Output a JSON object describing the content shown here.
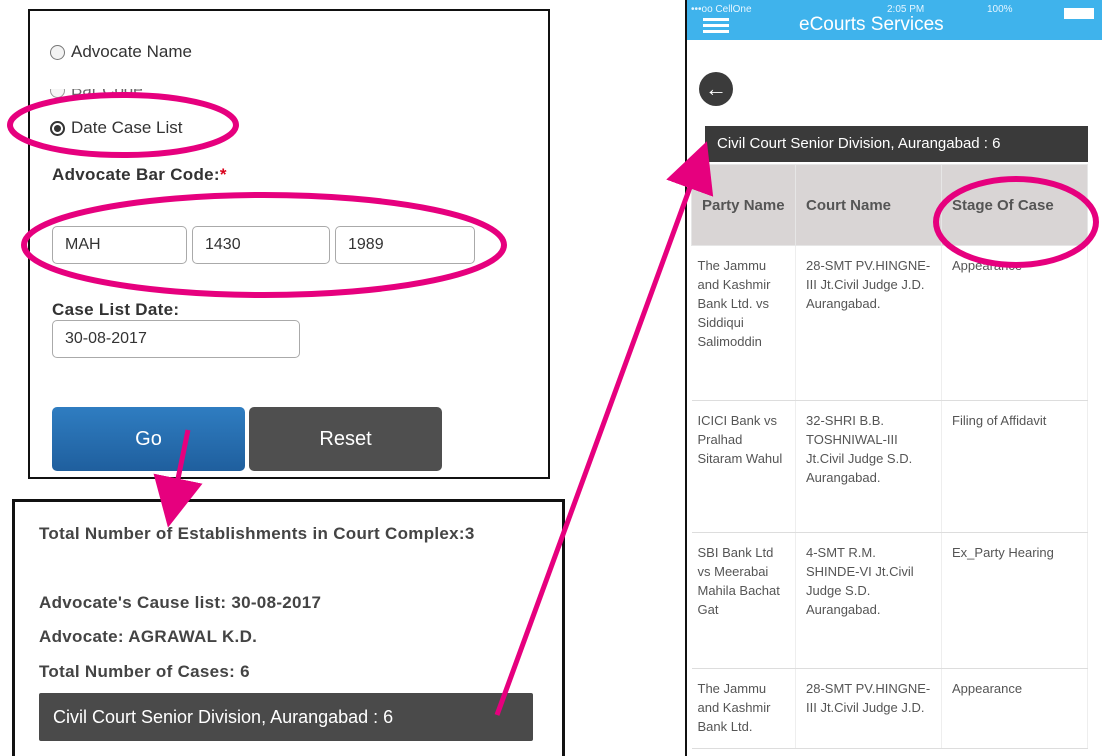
{
  "form": {
    "radio_options": [
      {
        "label": "Advocate Name",
        "checked": false
      },
      {
        "label": "Bar Code",
        "checked": false
      },
      {
        "label": "Date Case List",
        "checked": true
      }
    ],
    "bar_code_label": "Advocate Bar Code:",
    "required_mark": "*",
    "bar_code_state": "MAH",
    "bar_code_number": "1430",
    "bar_code_year": "1989",
    "case_list_date_label": "Case List Date:",
    "case_list_date": "30-08-2017",
    "go_label": "Go",
    "reset_label": "Reset"
  },
  "summary": {
    "establishments": "Total Number of Establishments in Court Complex:3",
    "cause_list": "Advocate's Cause list: 30-08-2017",
    "advocate": "Advocate: AGRAWAL K.D.",
    "total_cases": "Total Number of Cases: 6",
    "court_item": "Civil Court Senior Division, Aurangabad : 6"
  },
  "phone": {
    "carrier": "•••oo CellOne",
    "time": "2:05 PM",
    "battery": "100%",
    "app_title": "eCourts Services",
    "back_icon": "arrow-left-icon",
    "court_header": "Civil Court Senior Division, Aurangabad : 6",
    "table": {
      "headers": [
        "Party Name",
        "Court Name",
        "Stage Of Case"
      ],
      "rows": [
        {
          "party": "The Jammu and Kashmir Bank Ltd. vs Siddiqui Salimoddin",
          "court": "28-SMT PV.HINGNE-III Jt.Civil Judge J.D. Aurangabad.",
          "stage": "Appearance"
        },
        {
          "party": "ICICI Bank vs Pralhad Sitaram Wahul",
          "court": "32-SHRI B.B. TOSHNIWAL-III Jt.Civil Judge S.D. Aurangabad.",
          "stage": "Filing of Affidavit"
        },
        {
          "party": "SBI Bank Ltd vs Meerabai Mahila Bachat Gat",
          "court": "4-SMT R.M. SHINDE-VI Jt.Civil Judge S.D. Aurangabad.",
          "stage": "Ex_Party Hearing"
        },
        {
          "party": "The Jammu and Kashmir Bank Ltd.",
          "court": "28-SMT PV.HINGNE-III Jt.Civil Judge J.D.",
          "stage": "Appearance"
        }
      ]
    }
  },
  "colors": {
    "highlight": "#e6007e",
    "go_button": "#2a72b5",
    "dark_bar": "#4a4a4a",
    "status_bar": "#3fb3ec"
  }
}
